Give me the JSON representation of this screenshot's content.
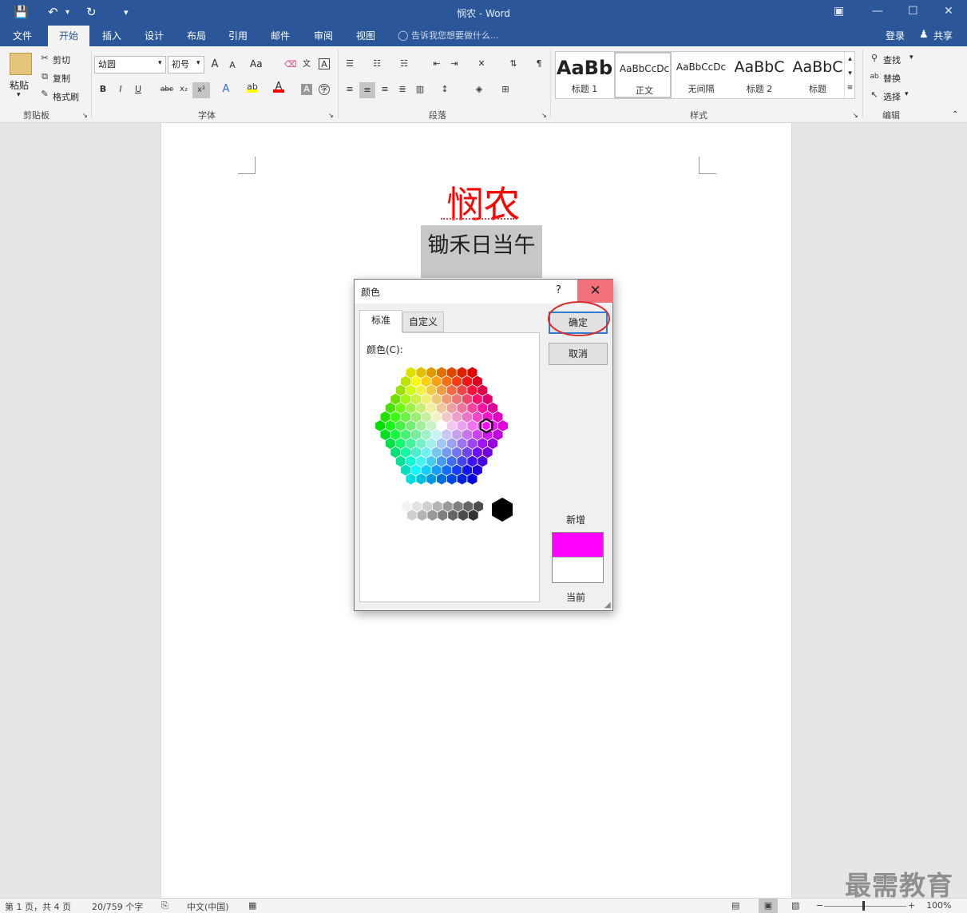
{
  "app": {
    "window_title": "悯农 - Word",
    "quick_access": {
      "save_icon": "save-icon",
      "undo_icon": "undo-icon",
      "redo_icon": "redo-icon",
      "customize_icon": "customize-icon"
    }
  },
  "menu": {
    "tabs": [
      "文件",
      "开始",
      "插入",
      "设计",
      "布局",
      "引用",
      "邮件",
      "审阅",
      "视图"
    ],
    "active": "开始",
    "tell_me": "告诉我您想要做什么...",
    "login": "登录",
    "share": "共享"
  },
  "ribbon": {
    "clipboard": {
      "paste": "粘贴",
      "cut": "剪切",
      "copy": "复制",
      "format_painter": "格式刷",
      "label": "剪贴板"
    },
    "font": {
      "font_name": "幼圆",
      "font_size": "初号",
      "label": "字体",
      "bold": "B",
      "italic": "I",
      "underline": "U",
      "strike": "abc",
      "sub": "x₂",
      "sup": "x²",
      "case": "Aa"
    },
    "paragraph": {
      "label": "段落"
    },
    "styles": {
      "items": [
        {
          "sample": "AaBb",
          "name": "标题 1"
        },
        {
          "sample": "AaBbCcDc",
          "name": "正文"
        },
        {
          "sample": "AaBbCcDc",
          "name": "无间隔"
        },
        {
          "sample": "AaBbC",
          "name": "标题 2"
        },
        {
          "sample": "AaBbC",
          "name": "标题"
        }
      ],
      "label": "样式"
    },
    "editing": {
      "find": "查找",
      "replace": "替换",
      "select": "选择",
      "label": "编辑"
    }
  },
  "document": {
    "title": "悯农",
    "line1": "锄禾日当午"
  },
  "dialog": {
    "title": "颜色",
    "help": "?",
    "tabs": [
      "标准",
      "自定义"
    ],
    "colors_label": "颜色(C):",
    "ok": "确定",
    "cancel": "取消",
    "new_label": "新增",
    "current_label": "当前",
    "new_color": "#FF00FF",
    "current_color": "#FFFFFF"
  },
  "status": {
    "page": "第 1 页，共 4 页",
    "words": "20/759 个字",
    "language": "中文(中国)",
    "zoom": "100%"
  },
  "watermark": "最需教育"
}
